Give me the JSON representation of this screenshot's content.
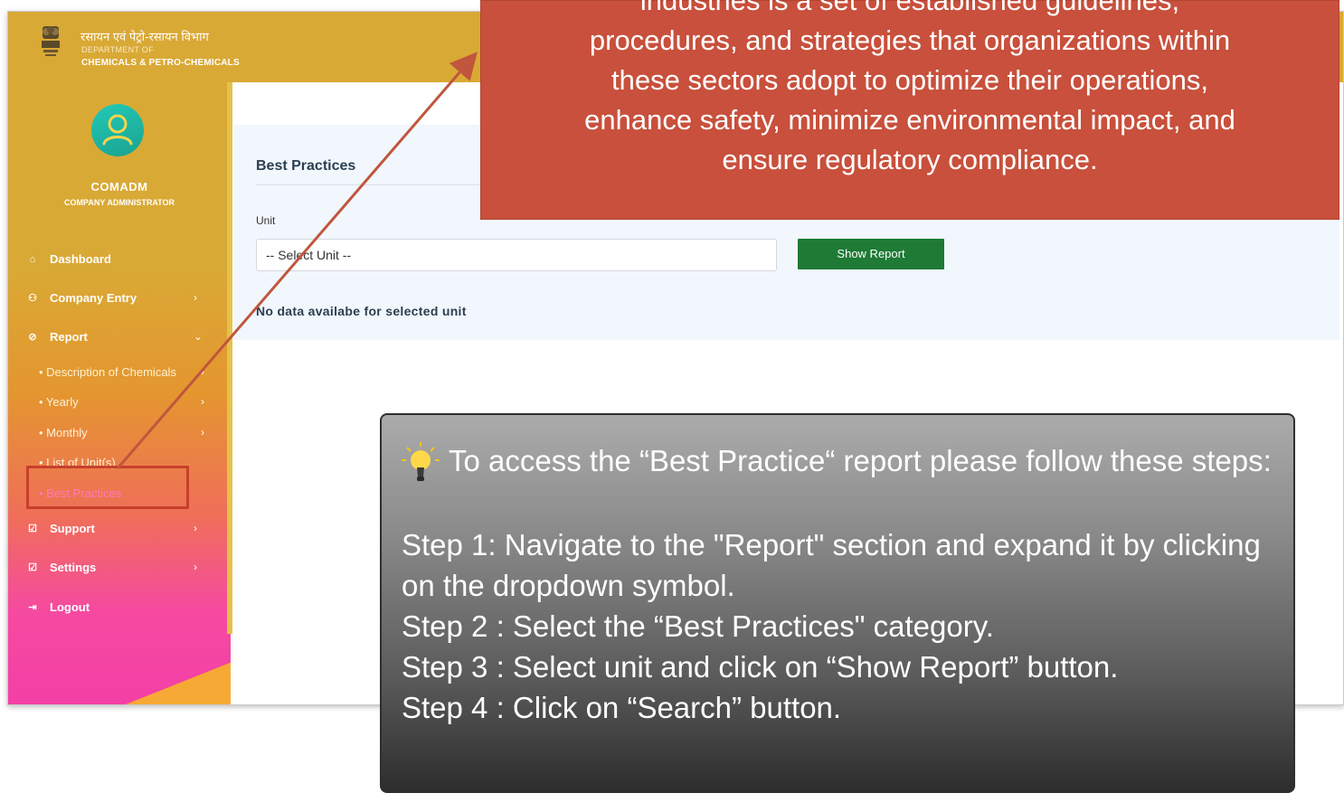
{
  "brand": {
    "hindi": "रसायन एवं पेट्रो-रसायन विभाग",
    "department_of": "DEPARTMENT OF",
    "name": "CHEMICALS & PETRO-CHEMICALS"
  },
  "user": {
    "name": "COMADM",
    "role": "COMPANY ADMINISTRATOR"
  },
  "sidebar": {
    "items": [
      {
        "label": "Dashboard",
        "icon": "home-icon"
      },
      {
        "label": "Company Entry",
        "icon": "user-plus-icon"
      },
      {
        "label": "Report",
        "icon": "check-circle-icon"
      },
      {
        "label": "Support",
        "icon": "check-square-icon"
      },
      {
        "label": "Settings",
        "icon": "check-square-icon"
      },
      {
        "label": "Logout",
        "icon": "logout-icon"
      }
    ],
    "report_sub_items": [
      {
        "label": "• Description of Chemicals"
      },
      {
        "label": "• Yearly"
      },
      {
        "label": "• Monthly"
      },
      {
        "label": "• List of Unit(s)"
      },
      {
        "label": "• Best Practices"
      }
    ]
  },
  "main": {
    "title": "Best Practices",
    "unit_label": "Unit",
    "unit_select_value": "-- Select Unit --",
    "show_report_label": "Show Report",
    "no_data_text": "No data availabe for selected unit"
  },
  "callouts": {
    "red_lines": [
      "industries is a set of established guidelines,",
      "procedures, and strategies that organizations within",
      "these sectors adopt to optimize their operations,",
      "enhance safety, minimize environmental impact, and",
      "ensure regulatory compliance."
    ],
    "tip_intro": "To access the “Best Practice“ report please follow these steps:",
    "steps": [
      "Step 1: Navigate to the \"Report\" section and expand it by clicking on the dropdown symbol.",
      "Step 2 : Select the “Best Practices\" category.",
      "Step 3 : Select unit and click on “Show Report” button.",
      "Step 4 : Click on “Search” button."
    ]
  },
  "colors": {
    "topbar": "#d9a935",
    "show_report_button": "#1e7a34",
    "red_callout": "#c8503c",
    "highlight_box": "#c7402c",
    "active_sub_item": "#ff7ab9"
  }
}
